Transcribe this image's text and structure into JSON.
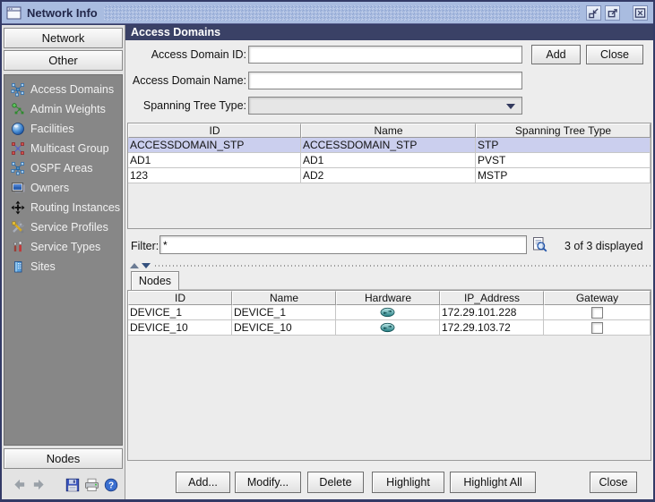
{
  "window": {
    "title": "Network Info",
    "controls": [
      {
        "name": "iconify",
        "glyph": "minimize-to-corner"
      },
      {
        "name": "maximize",
        "glyph": "expand-arrow"
      },
      {
        "name": "close",
        "glyph": "x-in-box"
      }
    ]
  },
  "sidebar": {
    "top_buttons": [
      {
        "label": "Network"
      },
      {
        "label": "Other"
      }
    ],
    "items": [
      {
        "label": "Access Domains",
        "icon": "access-domains-icon"
      },
      {
        "label": "Admin Weights",
        "icon": "admin-weights-icon"
      },
      {
        "label": "Facilities",
        "icon": "facilities-icon"
      },
      {
        "label": "Multicast Group",
        "icon": "multicast-group-icon"
      },
      {
        "label": "OSPF Areas",
        "icon": "ospf-areas-icon"
      },
      {
        "label": "Owners",
        "icon": "owners-icon"
      },
      {
        "label": "Routing Instances",
        "icon": "routing-instances-icon"
      },
      {
        "label": "Service Profiles",
        "icon": "service-profiles-icon"
      },
      {
        "label": "Service Types",
        "icon": "service-types-icon"
      },
      {
        "label": "Sites",
        "icon": "sites-icon"
      }
    ],
    "nodes_button": {
      "label": "Nodes"
    },
    "toolbar": [
      {
        "name": "back",
        "icon": "back-arrow-icon"
      },
      {
        "name": "forward",
        "icon": "forward-arrow-icon"
      },
      {
        "name": "save",
        "icon": "save-icon"
      },
      {
        "name": "print",
        "icon": "print-icon"
      },
      {
        "name": "help",
        "icon": "help-icon"
      }
    ]
  },
  "main": {
    "header": "Access Domains",
    "form": {
      "id_label": "Access Domain ID:",
      "id_value": "",
      "name_label": "Access Domain Name:",
      "name_value": "",
      "stp_label": "Spanning Tree Type:",
      "stp_value": "",
      "add_label": "Add",
      "close_label": "Close"
    },
    "domains_table": {
      "columns": [
        "ID",
        "Name",
        "Spanning Tree Type"
      ],
      "rows": [
        {
          "id": "ACCESSDOMAIN_STP",
          "name": "ACCESSDOMAIN_STP",
          "stp": "STP",
          "selected": true
        },
        {
          "id": "AD1",
          "name": "AD1",
          "stp": "PVST",
          "selected": false
        },
        {
          "id": "123",
          "name": "AD2",
          "stp": "MSTP",
          "selected": false
        }
      ]
    },
    "filter": {
      "label": "Filter:",
      "value": "*",
      "status": "3 of 3 displayed"
    },
    "tabs": [
      {
        "label": "Nodes",
        "active": true
      }
    ],
    "nodes_table": {
      "columns": [
        "ID",
        "Name",
        "Hardware",
        "IP_Address",
        "Gateway"
      ],
      "rows": [
        {
          "id": "DEVICE_1",
          "name": "DEVICE_1",
          "hardware_icon": "router-icon",
          "ip": "172.29.101.228",
          "gateway_checked": false
        },
        {
          "id": "DEVICE_10",
          "name": "DEVICE_10",
          "hardware_icon": "router-icon",
          "ip": "172.29.103.72",
          "gateway_checked": false
        }
      ]
    },
    "action_buttons": [
      {
        "label": "Add..."
      },
      {
        "label": "Modify..."
      },
      {
        "label": "Delete"
      },
      {
        "label": "Highlight"
      },
      {
        "label": "Highlight All"
      },
      {
        "label": "Close"
      }
    ]
  },
  "colors": {
    "window_border": "#333a66",
    "titlebar": "#a9bce0",
    "header_bar": "#3a4166",
    "sidebar_panel": "#878787",
    "selection_row": "#cbcfee",
    "panel": "#ededed"
  }
}
